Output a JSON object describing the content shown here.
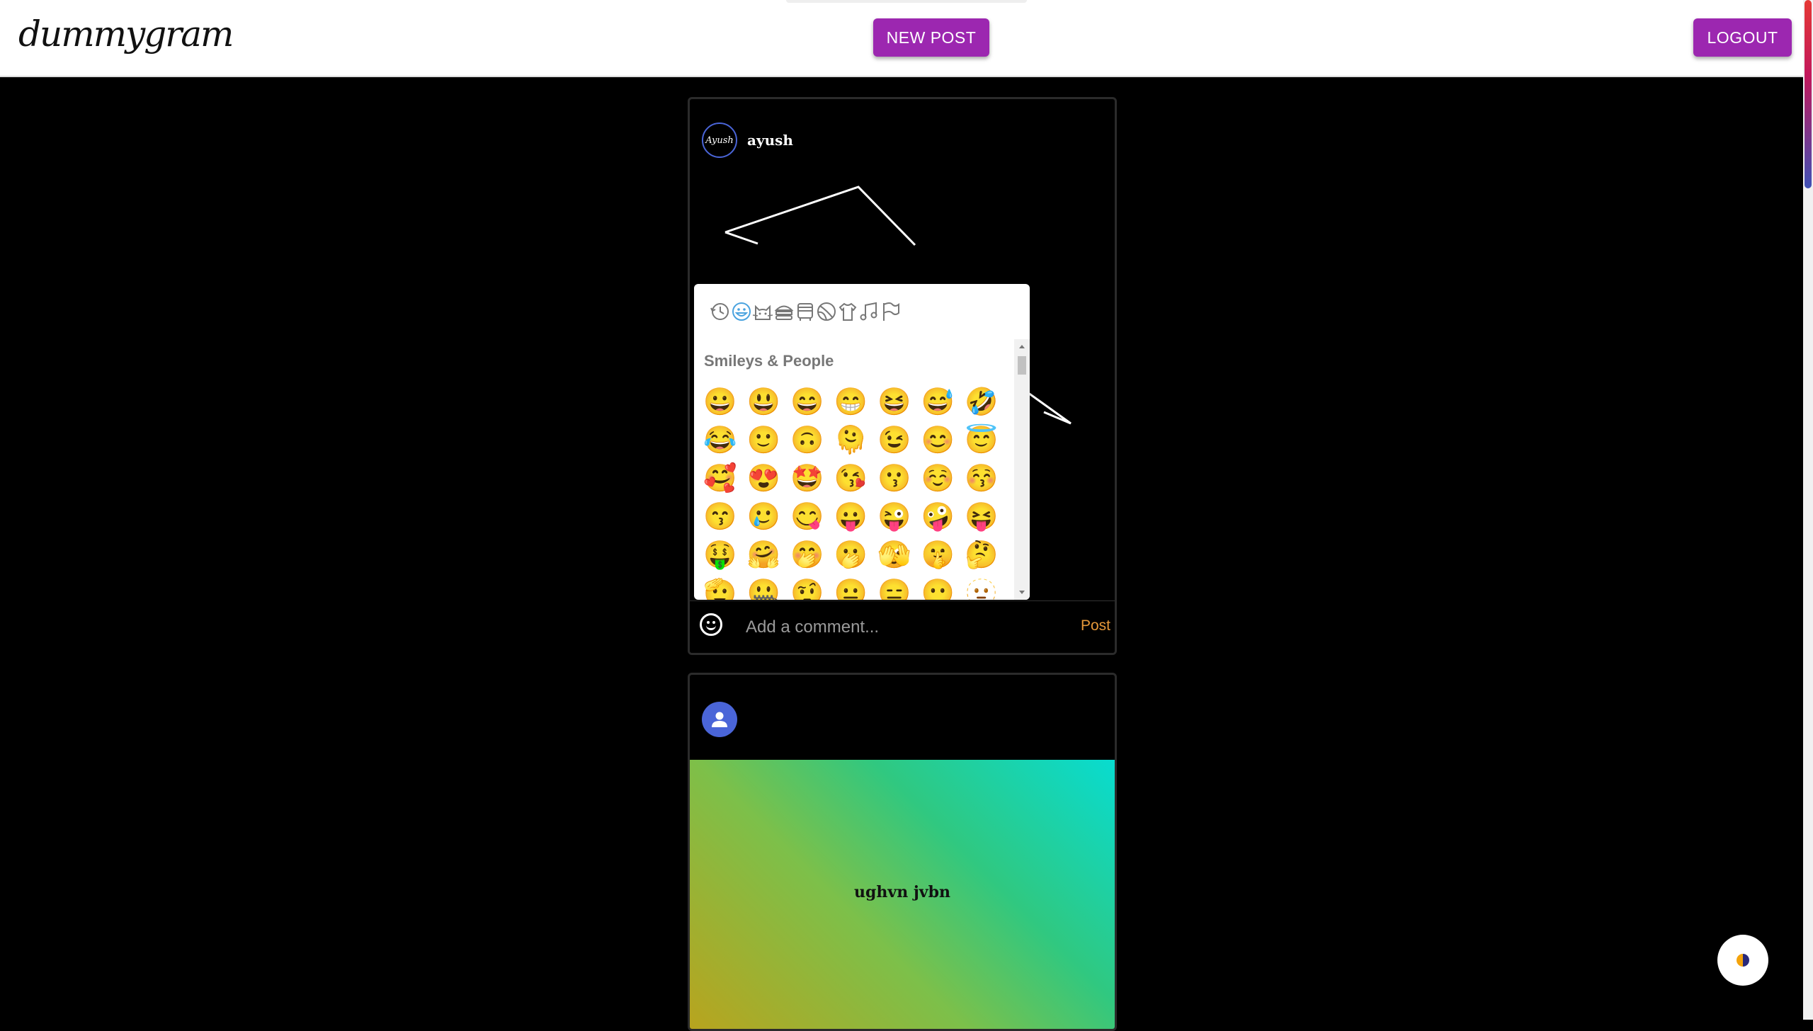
{
  "header": {
    "logo_text": "dummygram",
    "new_post_label": "NEW POST",
    "logout_label": "LOGOUT"
  },
  "colors": {
    "accent": "#9c27b0",
    "avatar_ring": "#4a65d8",
    "post_link": "#e6993a"
  },
  "posts": [
    {
      "username": "ayush",
      "avatar_text": "Ayush",
      "image": "line-drawing-icon",
      "comment": {
        "placeholder": "Add a comment...",
        "post_label": "Post",
        "emoji_toggle_icon": "smiley-icon"
      }
    },
    {
      "avatar_icon": "person-icon",
      "caption": "ughvn jvbn"
    }
  ],
  "emoji_picker": {
    "categories": [
      "recent-icon",
      "smileys-icon",
      "animals-icon",
      "food-icon",
      "travel-icon",
      "activities-icon",
      "objects-icon",
      "symbols-icon",
      "flags-icon"
    ],
    "active_category": "smileys-icon",
    "section_title": "Smileys & People",
    "emojis": [
      [
        "😀",
        "😃",
        "😄",
        "😁",
        "😆",
        "😅",
        "🤣"
      ],
      [
        "😂",
        "🙂",
        "🙃",
        "🫠",
        "😉",
        "😊",
        "😇"
      ],
      [
        "🥰",
        "😍",
        "🤩",
        "😘",
        "😗",
        "☺️",
        "😚"
      ],
      [
        "😙",
        "🥲",
        "😋",
        "😛",
        "😜",
        "🤪",
        "😝"
      ],
      [
        "🤑",
        "🤗",
        "🤭",
        "🫢",
        "🫣",
        "🤫",
        "🤔"
      ],
      [
        "🫡",
        "🤐",
        "🤨",
        "😐",
        "😑",
        "😶",
        "🫥"
      ]
    ]
  },
  "theme_toggle_icon": "half-circle-icon"
}
